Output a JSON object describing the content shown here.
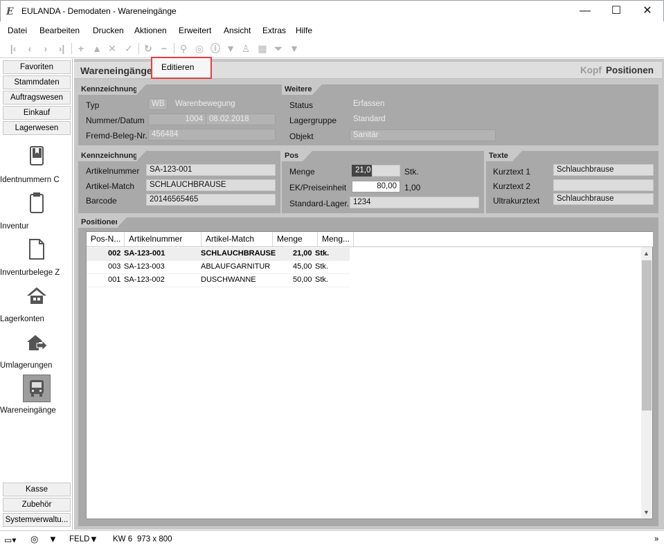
{
  "window": {
    "title": "EULANDA - Demodaten - Wareneingänge",
    "logo": "E"
  },
  "menu": [
    "Datei",
    "Bearbeiten",
    "Drucken",
    "Aktionen",
    "Erweitert",
    "Ansicht",
    "Extras",
    "Hilfe"
  ],
  "nav": {
    "top_buttons": [
      "Favoriten",
      "Stammdaten",
      "Auftragswesen",
      "Einkauf",
      "Lagerwesen"
    ],
    "tiles": [
      "Identnummern C",
      "Inventur",
      "Inventurbelege Z",
      "Lagerkonten",
      "Umlagerungen",
      "Wareneingänge"
    ],
    "bottom_buttons": [
      "Kasse",
      "Zubehör",
      "Systemverwaltu..."
    ]
  },
  "header": {
    "title": "Wareneingänge",
    "popup": "Editieren",
    "tab_kopf": "Kopf",
    "tab_positionen": "Positionen"
  },
  "kopf": {
    "heading": "Kennzeichnung",
    "typ_label": "Typ",
    "typ_code": "WB",
    "typ_text": "Warenbewegung",
    "nummer_label": "Nummer/Datum",
    "nummer": "1004",
    "datum": "08.02.2018",
    "fremd_label": "Fremd-Beleg-Nr.",
    "fremd": "456484"
  },
  "weitere": {
    "heading": "Weitere",
    "status_label": "Status",
    "status": "Erfassen",
    "lagergruppe_label": "Lagergruppe",
    "lagergruppe": "Standard",
    "objekt_label": "Objekt",
    "objekt": "Sanitär"
  },
  "artikel": {
    "heading": "Kennzeichnung",
    "artikelnummer_label": "Artikelnummer",
    "artikelnummer": "SA-123-001",
    "match_label": "Artikel-Match",
    "match": "SCHLAUCHBRAUSE",
    "barcode_label": "Barcode",
    "barcode": "20146565465"
  },
  "pos": {
    "heading": "Pos",
    "menge_label": "Menge",
    "menge": "21,00",
    "menge_unit": "Stk.",
    "ek_label": "EK/Preiseinheit",
    "ek": "80,00",
    "ek_unit": "1,00",
    "lager_label": "Standard-Lager.",
    "lager": "1234"
  },
  "texte": {
    "heading": "Texte",
    "k1_label": "Kurztext 1",
    "k1": "Schlauchbrause",
    "k2_label": "Kurztext 2",
    "k2": "",
    "uk_label": "Ultrakurztext",
    "uk": "Schlauchbrause"
  },
  "positionen": {
    "heading": "Positionen",
    "columns": [
      "Pos-N...",
      "Artikelnummer",
      "Artikel-Match",
      "Menge",
      "Meng..."
    ],
    "rows": [
      [
        "002",
        "SA-123-001",
        "SCHLAUCHBRAUSE",
        "21,00",
        "Stk."
      ],
      [
        "003",
        "SA-123-003",
        "ABLAUFGARNITUR",
        "45,00",
        "Stk."
      ],
      [
        "001",
        "SA-123-002",
        "DUSCHWANNE",
        "50,00",
        "Stk."
      ]
    ]
  },
  "status": {
    "feld": "FELD",
    "kw": "KW 6",
    "size": "973 x 800"
  },
  "colors": {
    "highlight_border": "#e0413f",
    "panel_bg": "#a9a9a9",
    "workspace_bg": "#c8c8c8"
  }
}
